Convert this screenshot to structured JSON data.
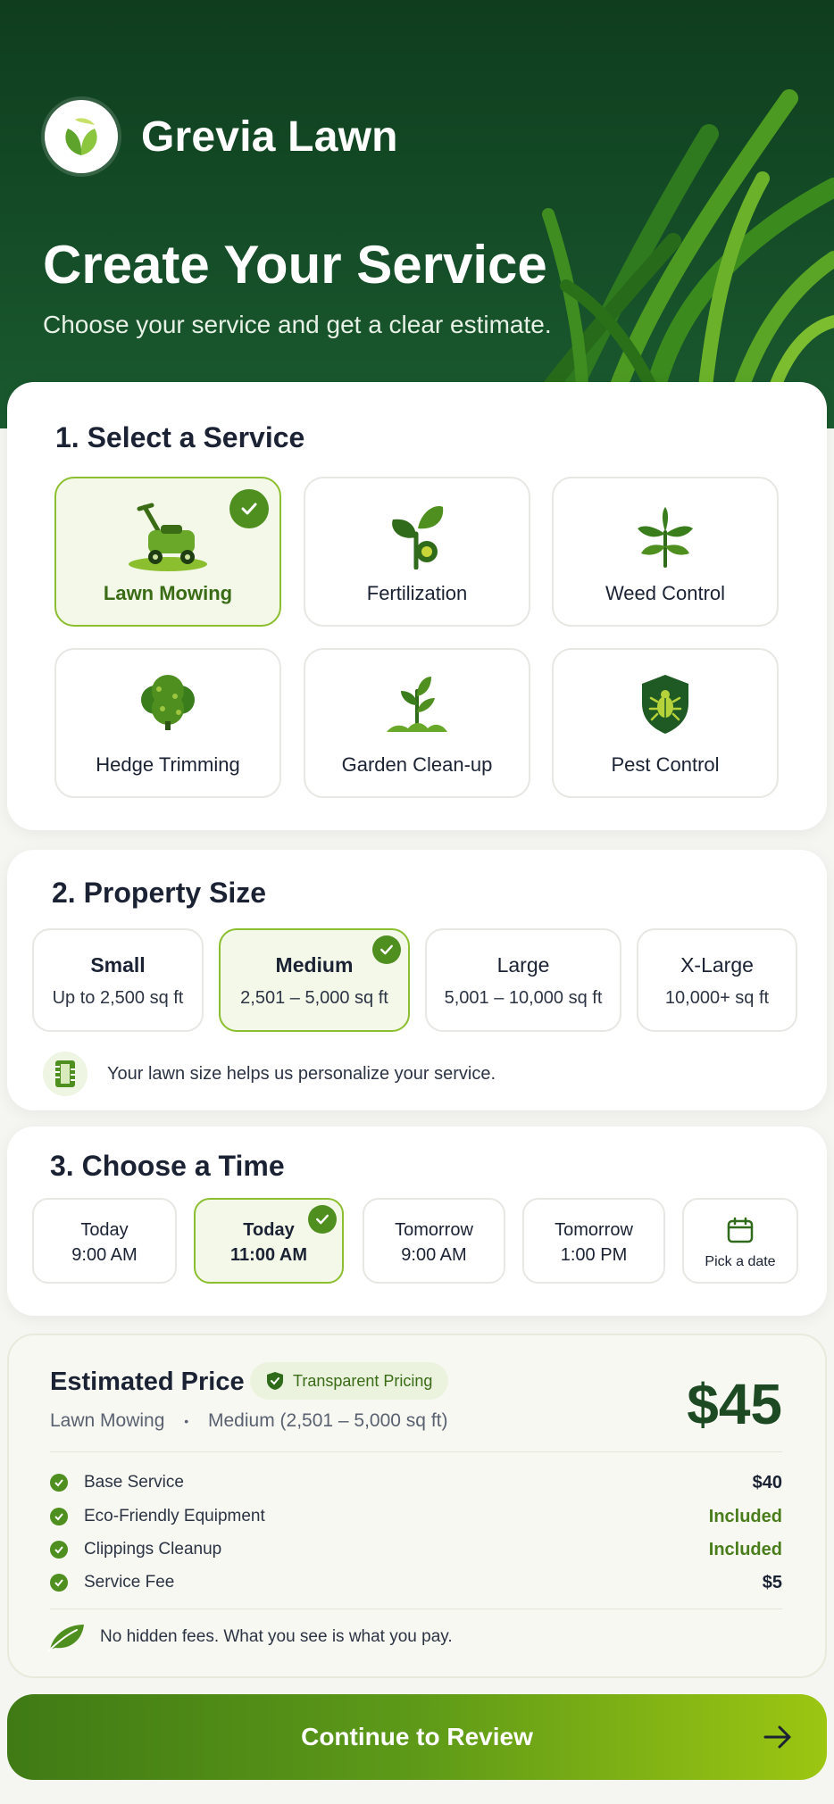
{
  "brand": {
    "name": "Grevia Lawn",
    "logo_icon": "leaf-logo-icon"
  },
  "hero": {
    "title": "Create Your Service",
    "subtitle": "Choose your service and get a clear estimate."
  },
  "colors": {
    "primary_dark": "#16512a",
    "accent": "#4f8f1f",
    "accent_light": "#8cbf2f"
  },
  "services": {
    "title": "1. Select a Service",
    "selected": "Lawn Mowing",
    "items": [
      {
        "label": "Lawn Mowing",
        "icon": "lawn-mower-icon"
      },
      {
        "label": "Fertilization",
        "icon": "fertilizer-sprout-icon"
      },
      {
        "label": "Weed Control",
        "icon": "weed-icon"
      },
      {
        "label": "Hedge Trimming",
        "icon": "hedge-icon"
      },
      {
        "label": "Garden Clean-up",
        "icon": "garden-sprout-icon"
      },
      {
        "label": "Pest Control",
        "icon": "pest-shield-icon"
      }
    ]
  },
  "property": {
    "title": "2. Property Size",
    "selected": "Medium",
    "items": [
      {
        "name": "Small",
        "desc": "Up to 2,500 sq ft"
      },
      {
        "name": "Medium",
        "desc": "2,501 – 5,000 sq ft"
      },
      {
        "name": "Large",
        "desc": "5,001 – 10,000 sq ft"
      },
      {
        "name": "X-Large",
        "desc": "10,000+ sq ft"
      }
    ],
    "hint": "Your lawn size helps us personalize your service."
  },
  "time": {
    "title": "3. Choose a Time",
    "selected_index": 1,
    "items": [
      {
        "day": "Today",
        "hour": "9:00 AM"
      },
      {
        "day": "Today",
        "hour": "11:00 AM"
      },
      {
        "day": "Tomorrow",
        "hour": "9:00 AM"
      },
      {
        "day": "Tomorrow",
        "hour": "1:00 PM"
      }
    ],
    "pick_date": "Pick a date"
  },
  "estimate": {
    "title": "Estimated Price",
    "badge": "Transparent Pricing",
    "service": "Lawn Mowing",
    "separator": "•",
    "size": "Medium (2,501 – 5,000 sq ft)",
    "total": "$45",
    "lines": [
      {
        "name": "Base Service",
        "value": "$40"
      },
      {
        "name": "Eco-Friendly Equipment",
        "value": "Included"
      },
      {
        "name": "Clippings Cleanup",
        "value": "Included"
      },
      {
        "name": "Service Fee",
        "value": "$5"
      }
    ],
    "footnote": "No hidden fees. What you see is what you pay."
  },
  "cta": {
    "label": "Continue to Review"
  }
}
